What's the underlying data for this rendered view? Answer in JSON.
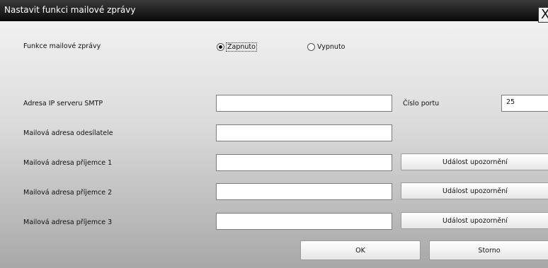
{
  "window": {
    "title": "Nastavit funkci mailové zprávy",
    "close_glyph": "X",
    "close_icon": "close-icon"
  },
  "mail_function": {
    "label": "Funkce mailové zprávy",
    "options": [
      {
        "label": "Zapnuto",
        "selected": true
      },
      {
        "label": "Vypnuto",
        "selected": false
      }
    ]
  },
  "fields": {
    "smtp_label": "Adresa IP serveru SMTP",
    "smtp_value": "",
    "port_label": "Číslo portu",
    "port_value": "25",
    "sender_label": "Mailová adresa odesílatele",
    "sender_value": "",
    "recipients": [
      {
        "label": "Mailová adresa příjemce 1",
        "value": "",
        "button": "Událost upozornění"
      },
      {
        "label": "Mailová adresa příjemce 2",
        "value": "",
        "button": "Událost upozornění"
      },
      {
        "label": "Mailová adresa příjemce 3",
        "value": "",
        "button": "Událost upozornění"
      }
    ]
  },
  "footer": {
    "ok_label": "OK",
    "cancel_label": "Storno"
  }
}
